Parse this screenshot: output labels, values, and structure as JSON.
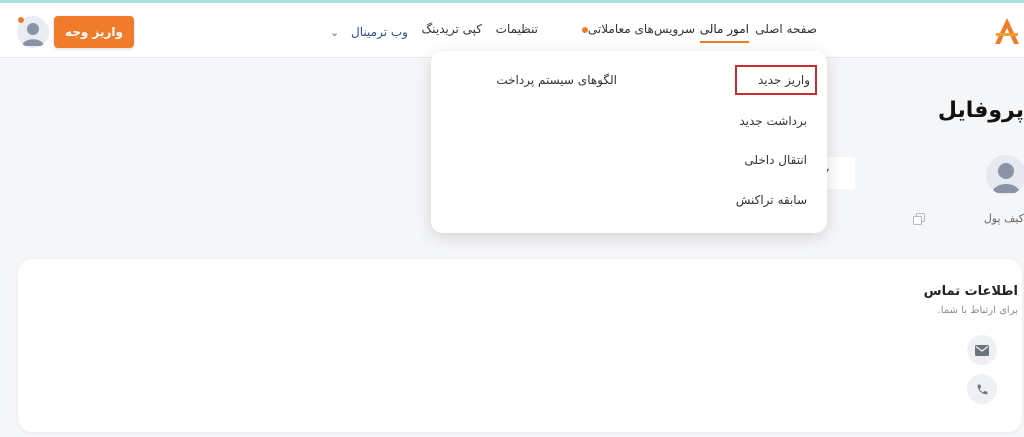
{
  "header": {
    "logo_label": "A",
    "nav": {
      "home": "صفحه اصلی",
      "finance": "امور مالی",
      "trade_services": "سرویس‌های معاملاتی",
      "settings": "تنظیمات",
      "copy_trading": "کپی تریدینگ",
      "web_terminal": "وب ترمینال"
    },
    "deposit_button": "واریز وجه"
  },
  "dropdown": {
    "new_deposit": "واریز جدید",
    "payment_patterns": "الگوهای سیستم پرداخت",
    "new_withdraw": "برداشت جدید",
    "internal_transfer": "انتقال داخلی",
    "transaction_history": "سابقه تراکنش"
  },
  "profile": {
    "title": "پروفایل",
    "wallet_label": "کیف پول"
  },
  "contact": {
    "title": "اطلاعات تماس",
    "subtitle": "برای ارتباط با شما."
  },
  "colors": {
    "accent": "#f07b2a",
    "highlight_border": "#d12a2a",
    "link_blue": "#2b4f8f"
  },
  "icons": {
    "logo": "brand-logo-icon",
    "avatar": "user-avatar-icon",
    "chevron": "chevron-down-icon",
    "copy": "copy-icon",
    "email": "email-icon",
    "phone": "phone-icon"
  }
}
